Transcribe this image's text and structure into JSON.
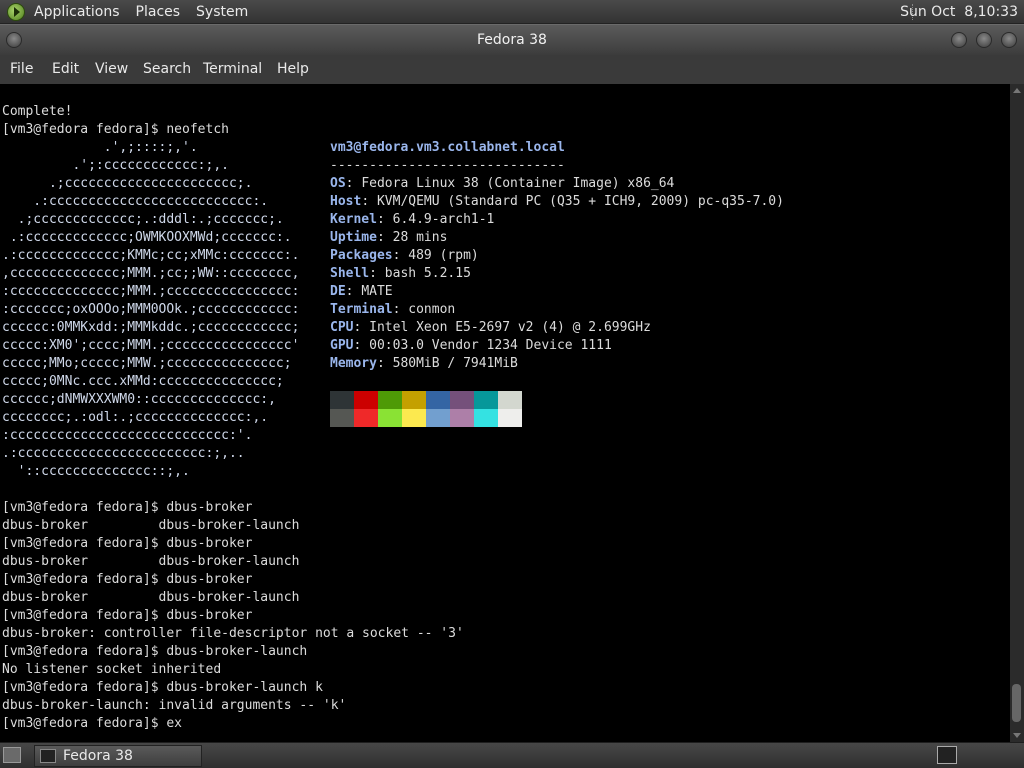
{
  "top_panel": {
    "menus": [
      "Applications",
      "Places",
      "System"
    ],
    "clock": "Sun Oct  8,10:33"
  },
  "window": {
    "title": "Fedora 38",
    "menu": [
      "File",
      "Edit",
      "View",
      "Search",
      "Terminal",
      "Help"
    ]
  },
  "terminal": {
    "lines_top": [
      "Complete!",
      "[vm3@fedora fedora]$ neofetch"
    ],
    "ascii_art": [
      "             .',;::::;,'.",
      "         .';:cccccccccccc:;,.",
      "      .;cccccccccccccccccccccc;.",
      "    .:cccccccccccccccccccccccccc:.",
      "  .;ccccccccccccc;.:dddl:.;ccccccc;.",
      " .:ccccccccccccc;OWMKOOXMWd;ccccccc:.",
      ".:ccccccccccccc;KMMc;cc;xMMc:ccccccc:.",
      ",cccccccccccccc;MMM.;cc;;WW::cccccccc,",
      ":cccccccccccccc;MMM.;cccccccccccccccc:",
      ":ccccccc;oxOOOo;MMM0OOk.;cccccccccccc:",
      "cccccc:0MMKxdd:;MMMkddc.;cccccccccccc;",
      "ccccc:XM0';cccc;MMM.;cccccccccccccccc'",
      "ccccc;MMo;ccccc;MMW.;ccccccccccccccc;",
      "ccccc;0MNc.ccc.xMMd:ccccccccccccccc;",
      "cccccc;dNMWXXXWM0::cccccccccccccc:,",
      "cccccccc;.:odl:.;cccccccccccccc:,.",
      ":cccccccccccccccccccccccccccc:'.",
      ".:cccccccccccccccccccccccc:;,..",
      "  '::cccccccccccccc::;,."
    ],
    "info_header": "vm3@fedora.vm3.collabnet.local",
    "info_rule": "------------------------------",
    "info": [
      {
        "key": "OS",
        "value": "Fedora Linux 38 (Container Image) x86_64"
      },
      {
        "key": "Host",
        "value": "KVM/QEMU (Standard PC (Q35 + ICH9, 2009) pc-q35-7.0)"
      },
      {
        "key": "Kernel",
        "value": "6.4.9-arch1-1"
      },
      {
        "key": "Uptime",
        "value": "28 mins"
      },
      {
        "key": "Packages",
        "value": "489 (rpm)"
      },
      {
        "key": "Shell",
        "value": "bash 5.2.15"
      },
      {
        "key": "DE",
        "value": "MATE"
      },
      {
        "key": "Terminal",
        "value": "conmon"
      },
      {
        "key": "CPU",
        "value": "Intel Xeon E5-2697 v2 (4) @ 2.699GHz"
      },
      {
        "key": "GPU",
        "value": "00:03.0 Vendor 1234 Device 1111"
      },
      {
        "key": "Memory",
        "value": "580MiB / 7941MiB"
      }
    ],
    "palette_dark": [
      "#2e3436",
      "#cc0000",
      "#4e9a06",
      "#c4a000",
      "#3465a4",
      "#75507b",
      "#06989a",
      "#d3d7cf"
    ],
    "palette_light": [
      "#555753",
      "#ef2929",
      "#8ae234",
      "#fce94f",
      "#729fcf",
      "#ad7fa8",
      "#34e2e2",
      "#eeeeec"
    ],
    "lines_bottom": [
      "[vm3@fedora fedora]$ dbus-broker",
      "dbus-broker         dbus-broker-launch",
      "[vm3@fedora fedora]$ dbus-broker",
      "dbus-broker         dbus-broker-launch",
      "[vm3@fedora fedora]$ dbus-broker",
      "dbus-broker         dbus-broker-launch",
      "[vm3@fedora fedora]$ dbus-broker",
      "dbus-broker: controller file-descriptor not a socket -- '3'",
      "[vm3@fedora fedora]$ dbus-broker-launch",
      "No listener socket inherited",
      "[vm3@fedora fedora]$ dbus-broker-launch k",
      "dbus-broker-launch: invalid arguments -- 'k'",
      "[vm3@fedora fedora]$ ex"
    ]
  },
  "taskbar": {
    "window_button": "Fedora 38"
  }
}
